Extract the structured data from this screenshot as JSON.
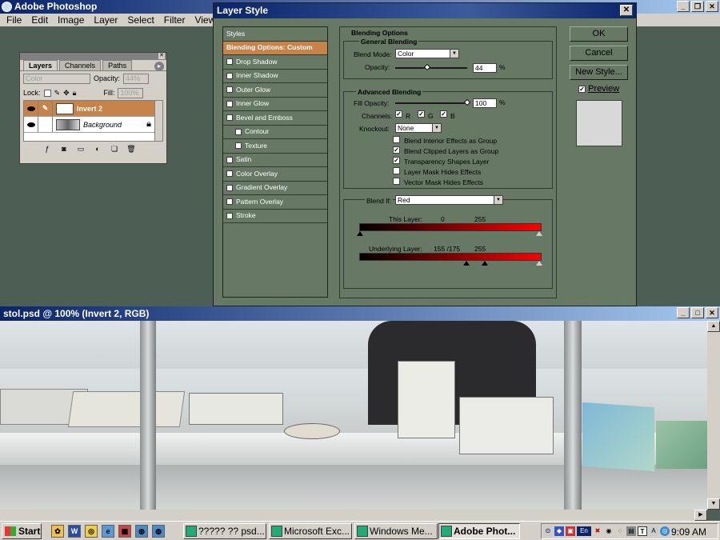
{
  "app": {
    "title": "Adobe Photoshop"
  },
  "menu": [
    "File",
    "Edit",
    "Image",
    "Layer",
    "Select",
    "Filter",
    "View"
  ],
  "layers_palette": {
    "tabs": [
      "Layers",
      "Channels",
      "Paths"
    ],
    "mode": "Color",
    "opacity_label": "Opacity:",
    "opacity_value": "44%",
    "lock_label": "Lock:",
    "fill_label": "Fill:",
    "fill_value": "100%",
    "layers": [
      {
        "name": "Invert 2",
        "selected": true
      },
      {
        "name": "Background",
        "selected": false
      }
    ]
  },
  "dialog": {
    "title": "Layer Style",
    "styles_header": "Styles",
    "style_items": [
      {
        "label": "Blending Options: Custom",
        "active": true,
        "checkbox": false,
        "sub": false
      },
      {
        "label": "Drop Shadow",
        "active": false,
        "checkbox": true,
        "sub": false
      },
      {
        "label": "Inner Shadow",
        "active": false,
        "checkbox": true,
        "sub": false
      },
      {
        "label": "Outer Glow",
        "active": false,
        "checkbox": true,
        "sub": false
      },
      {
        "label": "Inner Glow",
        "active": false,
        "checkbox": true,
        "sub": false
      },
      {
        "label": "Bevel and Emboss",
        "active": false,
        "checkbox": true,
        "sub": false
      },
      {
        "label": "Contour",
        "active": false,
        "checkbox": true,
        "sub": true
      },
      {
        "label": "Texture",
        "active": false,
        "checkbox": true,
        "sub": true
      },
      {
        "label": "Satin",
        "active": false,
        "checkbox": true,
        "sub": false
      },
      {
        "label": "Color Overlay",
        "active": false,
        "checkbox": true,
        "sub": false
      },
      {
        "label": "Gradient Overlay",
        "active": false,
        "checkbox": true,
        "sub": false
      },
      {
        "label": "Pattern Overlay",
        "active": false,
        "checkbox": true,
        "sub": false
      },
      {
        "label": "Stroke",
        "active": false,
        "checkbox": true,
        "sub": false
      }
    ],
    "blending_options": "Blending Options",
    "general_blending": "General Blending",
    "blend_mode_label": "Blend Mode:",
    "blend_mode_value": "Color",
    "opacity_label": "Opacity:",
    "opacity_value": "44",
    "opacity_pct": 44,
    "percent": "%",
    "advanced_blending": "Advanced Blending",
    "fill_opacity_label": "Fill Opacity:",
    "fill_opacity_value": "100",
    "fill_opacity_pct": 100,
    "channels_label": "Channels:",
    "channels": [
      {
        "name": "R",
        "checked": true
      },
      {
        "name": "G",
        "checked": true
      },
      {
        "name": "B",
        "checked": true
      }
    ],
    "knockout_label": "Knockout:",
    "knockout_value": "None",
    "options": [
      {
        "label": "Blend Interior Effects as Group",
        "checked": false
      },
      {
        "label": "Blend Clipped Layers as Group",
        "checked": true
      },
      {
        "label": "Transparency Shapes Layer",
        "checked": true
      },
      {
        "label": "Layer Mask Hides Effects",
        "checked": false
      },
      {
        "label": "Vector Mask Hides Effects",
        "checked": false
      }
    ],
    "blend_if_label": "Blend If:",
    "blend_if_value": "Red",
    "this_layer_label": "This Layer:",
    "this_layer_low": "0",
    "this_layer_high": "255",
    "underlying_label": "Underlying Layer:",
    "underlying_low": "155 /175",
    "underlying_high": "255",
    "buttons": {
      "ok": "OK",
      "cancel": "Cancel",
      "new_style": "New Style...",
      "preview": "Preview"
    },
    "preview_checked": true
  },
  "document": {
    "title": "stol.psd @ 100% (Invert 2, RGB)"
  },
  "taskbar": {
    "start": "Start",
    "tasks": [
      {
        "label": "????? ?? psd...",
        "pressed": false
      },
      {
        "label": "Microsoft Exc...",
        "pressed": false
      },
      {
        "label": "Windows Me...",
        "pressed": false
      },
      {
        "label": "Adobe Phot...",
        "pressed": true
      }
    ],
    "tray_lang": "En",
    "clock": "9:09 AM"
  }
}
